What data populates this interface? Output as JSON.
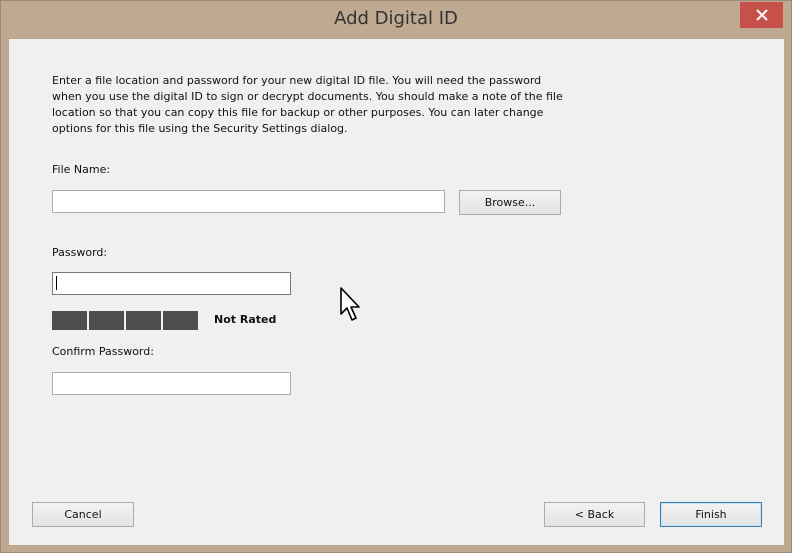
{
  "window": {
    "title": "Add Digital ID",
    "close_icon": "close-icon"
  },
  "description": "Enter a file location and password for your new digital ID file. You will need the password when you use the digital ID to sign or decrypt documents. You should make a note of the file location so that you can copy this file for backup or other purposes. You can later change options for this file using the Security Settings dialog.",
  "file_name": {
    "label": "File Name:",
    "value": "",
    "browse_label": "Browse..."
  },
  "password": {
    "label": "Password:",
    "value": "",
    "strength_label": "Not Rated",
    "strength_segments": 4,
    "strength_level": 0
  },
  "confirm_password": {
    "label": "Confirm Password:",
    "value": ""
  },
  "buttons": {
    "cancel": "Cancel",
    "back": "< Back",
    "finish": "Finish"
  },
  "colors": {
    "frame": "#bfa991",
    "client": "#f0f0f0",
    "close_button": "#c7504a",
    "meter_segment": "#4d4d4d",
    "default_button_border": "#3c7fb1"
  }
}
